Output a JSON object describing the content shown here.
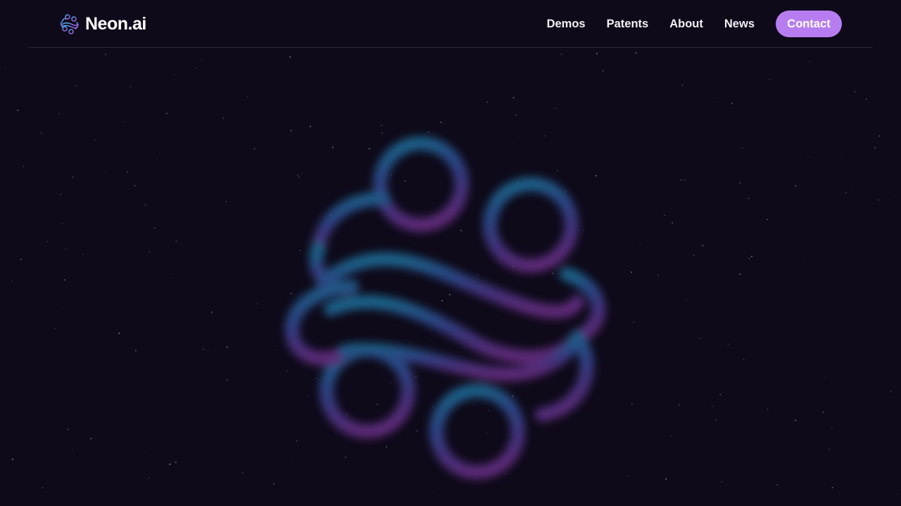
{
  "brand": {
    "name": "Neon.ai",
    "logo_icon": "neon-swirl-logo-icon"
  },
  "nav": {
    "items": [
      {
        "label": "Demos"
      },
      {
        "label": "Patents"
      },
      {
        "label": "About"
      },
      {
        "label": "News"
      }
    ],
    "contact_label": "Contact"
  },
  "hero": {
    "graphic": "blurred-neon-swirl-logo",
    "gradient_colors": [
      "#1f6f9a",
      "#2f4f96",
      "#4b3a8e",
      "#6b2f87"
    ]
  },
  "colors": {
    "background": "#0f0a1a",
    "accent": "#b77df0",
    "text": "#ffffff"
  }
}
